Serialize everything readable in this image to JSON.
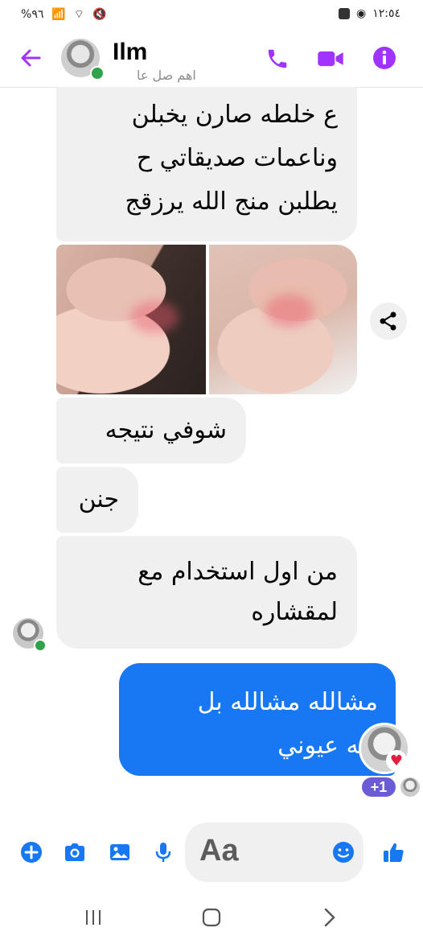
{
  "status_bar": {
    "battery": "%٩٦",
    "time": "١٢:٥٤"
  },
  "header": {
    "contact_name": "Ilm",
    "subtitle": "اهم صل عا"
  },
  "messages": [
    {
      "direction": "incoming",
      "lines": [
        "ع خلطه صارن يخبلن",
        "وناعمات صديقاتي ح",
        "يطلبن منج الله يرزقج"
      ]
    },
    {
      "direction": "incoming",
      "type": "photos",
      "count": 2
    },
    {
      "direction": "incoming",
      "text": "شوفي نتيجه"
    },
    {
      "direction": "incoming",
      "text": "جنن"
    },
    {
      "direction": "incoming",
      "lines": [
        "من اول استخدام مع",
        "لمقشاره"
      ]
    },
    {
      "direction": "outgoing",
      "lines": [
        "مشالله مشالله بل",
        "فيه عيوني"
      ]
    }
  ],
  "reaction": {
    "icon": "heart",
    "extra_count": "+1",
    "heart_color": "#e41e3f"
  },
  "composer": {
    "placeholder": "Aa"
  },
  "colors": {
    "accent": "#a033ff",
    "messenger_blue": "#1877f2",
    "incoming_bubble": "#f0f0f0",
    "online": "#31a24c"
  }
}
